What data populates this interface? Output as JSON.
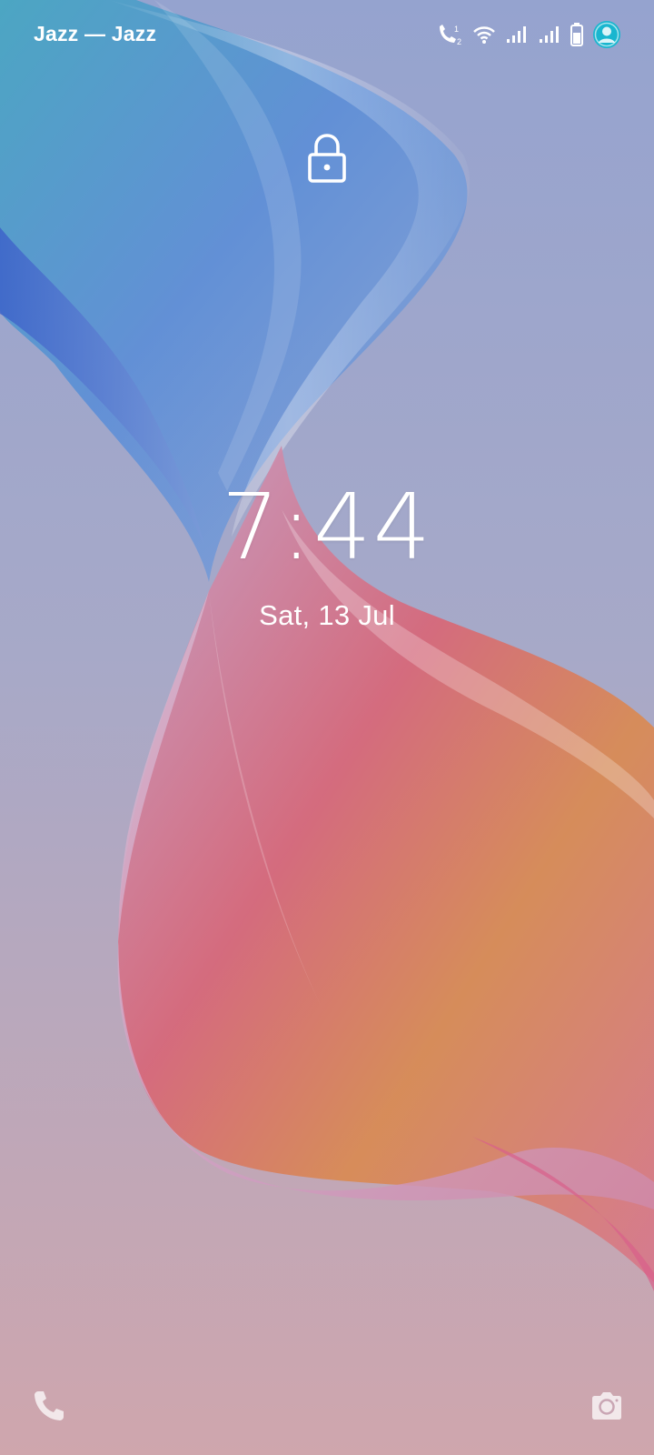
{
  "status_bar": {
    "carrier": "Jazz — Jazz",
    "icons": [
      "call-sim2-icon",
      "wifi-icon",
      "signal-icon",
      "signal-icon",
      "battery-icon",
      "user-avatar-icon"
    ],
    "avatar_color": "#19b6cf"
  },
  "lockscreen": {
    "lock_icon": "lock-icon",
    "time": "7:44",
    "date": "Sat, 13 Jul"
  },
  "shortcuts": {
    "left": "phone-icon",
    "right": "camera-icon"
  },
  "colors": {
    "background_top": "#9aa3cf",
    "background_bottom": "#cfa3aa",
    "ribbon_blue": "#5a84d6",
    "ribbon_red": "#d95a6a",
    "ribbon_orange": "#d9864e",
    "ribbon_pink": "#d6a6c4"
  }
}
